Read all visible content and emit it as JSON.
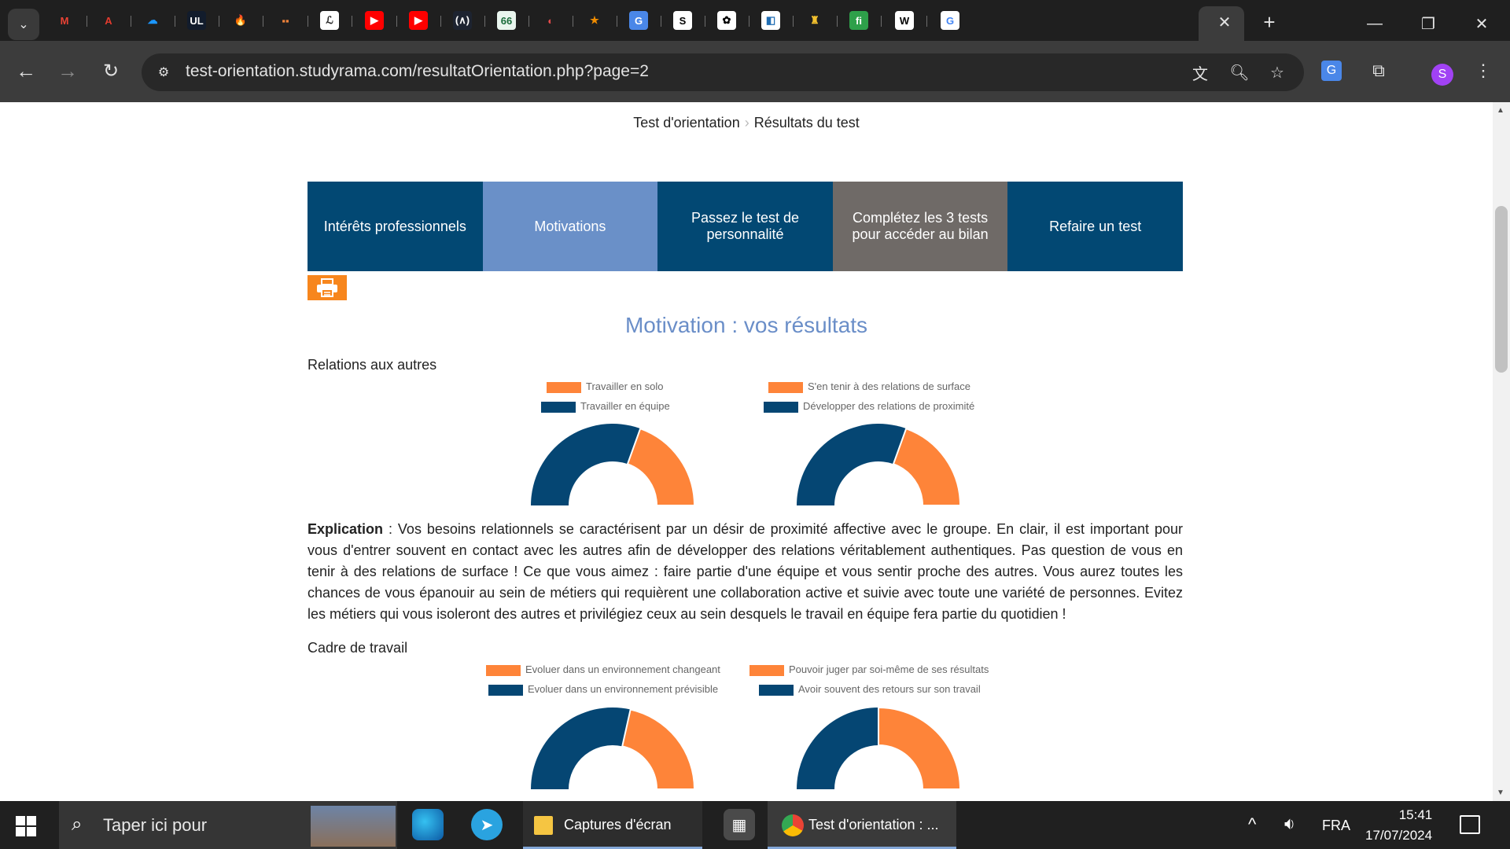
{
  "browser": {
    "url": "test-orientation.studyrama.com/resultatOrientation.php?page=2",
    "pinned_tabs": [
      {
        "icon": "gmail-icon",
        "glyph": "M",
        "color": "#ea4335",
        "bg": "transparent"
      },
      {
        "icon": "acrobat-icon",
        "glyph": "A",
        "color": "#e33b2e",
        "bg": "transparent"
      },
      {
        "icon": "salesforce-icon",
        "glyph": "☁",
        "color": "#1b96ff",
        "bg": "transparent"
      },
      {
        "icon": "ul-icon",
        "glyph": "UL",
        "color": "#ffffff",
        "bg": "#121c2c"
      },
      {
        "icon": "fire-icon",
        "glyph": "🔥",
        "color": "#f28a1e",
        "bg": "transparent"
      },
      {
        "icon": "media-icon",
        "glyph": "▪▪",
        "color": "#f0833a",
        "bg": "transparent"
      },
      {
        "icon": "app-icon",
        "glyph": "ℒ",
        "color": "#222",
        "bg": "#ffffff"
      },
      {
        "icon": "youtube-icon",
        "glyph": "▶",
        "color": "#fff",
        "bg": "#ff0000"
      },
      {
        "icon": "youtube-icon",
        "glyph": "▶",
        "color": "#fff",
        "bg": "#ff0000"
      },
      {
        "icon": "perplexity-icon",
        "glyph": "(∧)",
        "color": "#ffffff",
        "bg": "#1d2330"
      },
      {
        "icon": "66-icon",
        "glyph": "66",
        "color": "#1a6b3a",
        "bg": "#e9f5ee"
      },
      {
        "icon": "globe-icon",
        "glyph": "◐",
        "color": "#e24a4a",
        "bg": "transparent"
      },
      {
        "icon": "star-icon",
        "glyph": "★",
        "color": "#f08c00",
        "bg": "transparent"
      },
      {
        "icon": "translate-icon",
        "glyph": "G",
        "color": "#fff",
        "bg": "#4a87e8"
      },
      {
        "icon": "s-icon",
        "glyph": "S",
        "color": "#000",
        "bg": "#ffffff"
      },
      {
        "icon": "openai-icon",
        "glyph": "✿",
        "color": "#000",
        "bg": "#ffffff"
      },
      {
        "icon": "scan-icon",
        "glyph": "◧",
        "color": "#1f6db3",
        "bg": "#ffffff"
      },
      {
        "icon": "figure-icon",
        "glyph": "♜",
        "color": "#f2c12e",
        "bg": "transparent"
      },
      {
        "icon": "fn-icon",
        "glyph": "fi",
        "color": "#fff",
        "bg": "#2ea04a"
      },
      {
        "icon": "wikipedia-icon",
        "glyph": "W",
        "color": "#000",
        "bg": "#ffffff"
      },
      {
        "icon": "google-icon",
        "glyph": "G",
        "color": "#4285f4",
        "bg": "#ffffff"
      }
    ],
    "avatar_letter": "S"
  },
  "page": {
    "breadcrumb": {
      "home": "Test d'orientation",
      "current": "Résultats du test"
    },
    "menu": [
      {
        "label": "Intérêts professionnels",
        "bg": "#024873"
      },
      {
        "label": "Motivations",
        "bg": "#6a90c8"
      },
      {
        "label": "Passez le test de personnalité",
        "bg": "#024873"
      },
      {
        "label": "Complétez les 3 tests pour accéder au bilan",
        "bg": "#6f6a67"
      },
      {
        "label": "Refaire un test",
        "bg": "#024873"
      }
    ],
    "title": "Motivation : vos résultats",
    "colors": {
      "orange": "#fe8439",
      "navy": "#054673"
    },
    "sections": [
      {
        "title": "Relations aux autres",
        "charts": [
          {
            "legend_orange": "Travailler en solo",
            "legend_navy": "Travailler en équipe",
            "orange_share": 0.39
          },
          {
            "legend_orange": "S'en tenir à des relations de surface",
            "legend_navy": "Développer des relations de proximité",
            "orange_share": 0.39
          }
        ]
      },
      {
        "title": "Cadre de travail",
        "charts": [
          {
            "legend_orange": "Evoluer dans un environnement changeant",
            "legend_navy": "Evoluer dans un environnement prévisible",
            "orange_share": 0.43
          },
          {
            "legend_orange": "Pouvoir juger par soi-même de ses résultats",
            "legend_navy": "Avoir souvent des retours sur son travail",
            "orange_share": 0.5
          }
        ]
      }
    ],
    "explication": {
      "label": "Explication",
      "text": " : Vos besoins relationnels se caractérisent par un désir de proximité affective avec le groupe. En clair, il est important pour vous d'entrer souvent en contact avec les autres afin de développer des relations véritablement authentiques. Pas question de vous en tenir à des relations de surface ! Ce que vous aimez : faire partie d'une équipe et vous sentir proche des autres. Vous aurez toutes les chances de vous épanouir au sein de métiers qui requièrent une collaboration active et suivie avec toute une variété de personnes. Evitez les métiers qui vous isoleront des autres et privilégiez ceux au sein desquels le travail en équipe fera partie du quotidien !"
    }
  },
  "taskbar": {
    "search_placeholder": "Taper ici pour",
    "windows": [
      {
        "label": "Captures d'écran"
      },
      {
        "label": "Test d'orientation : ..."
      }
    ],
    "language": "FRA",
    "time": "15:41",
    "date": "17/07/2024"
  }
}
